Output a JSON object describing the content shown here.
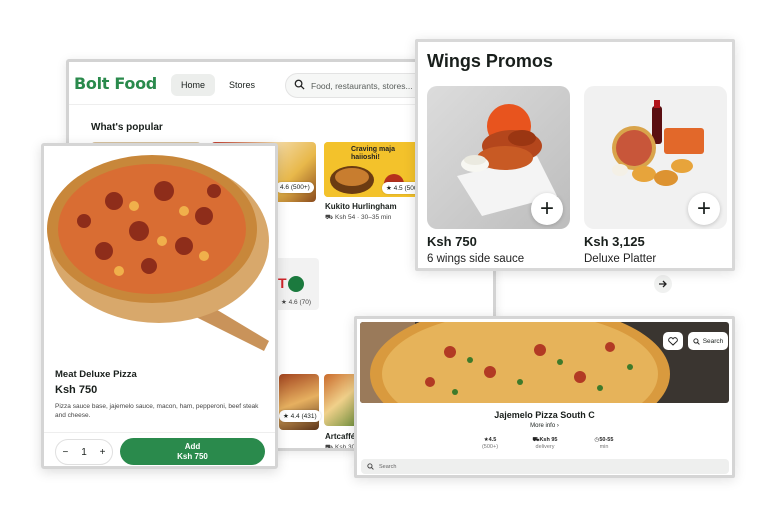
{
  "main": {
    "logo": "Bolt Food",
    "nav_home": "Home",
    "nav_stores": "Stores",
    "search_placeholder": "Food, restaurants, stores...",
    "section_title": "What's popular",
    "popular": [
      {
        "rating": "4.6 (500+)"
      },
      {
        "name": "Kukito Hurlingham",
        "rating": "4.5 (500",
        "meta": "Ksh 54  ·  30–35 min",
        "banner": "Craving maja haiioshi!"
      },
      {
        "rating": "4.6 (70)"
      },
      {
        "rating": "4.4 (431)"
      },
      {
        "name": "Artcaffé",
        "meta": "Ksh 30"
      }
    ]
  },
  "wings": {
    "title": "Wings Promos",
    "items": [
      {
        "price": "Ksh 750",
        "name": "6 wings side sauce"
      },
      {
        "price": "Ksh 3,125",
        "name": "Deluxe Platter"
      }
    ],
    "add_symbol": "+"
  },
  "dish": {
    "title": "Meat Deluxe Pizza",
    "price": "Ksh 750",
    "description": "Pizza sauce base, jajemelo sauce, macon, ham, pepperoni, beef steak and cheese.",
    "qty": "1",
    "minus": "−",
    "plus": "+",
    "add_label": "Add",
    "add_price": "Ksh 750"
  },
  "store": {
    "name": "Jajemelo Pizza South C",
    "more_info": "More info ›",
    "search_label": "Search",
    "search_placeholder": "Search",
    "stats": [
      {
        "value": "4.5",
        "label": "(500+)"
      },
      {
        "value": "Ksh 95",
        "label": "delivery"
      },
      {
        "value": "50-55",
        "label": "min"
      }
    ]
  },
  "colors": {
    "brand_green": "#2a8a4c",
    "text": "#191f1c"
  }
}
